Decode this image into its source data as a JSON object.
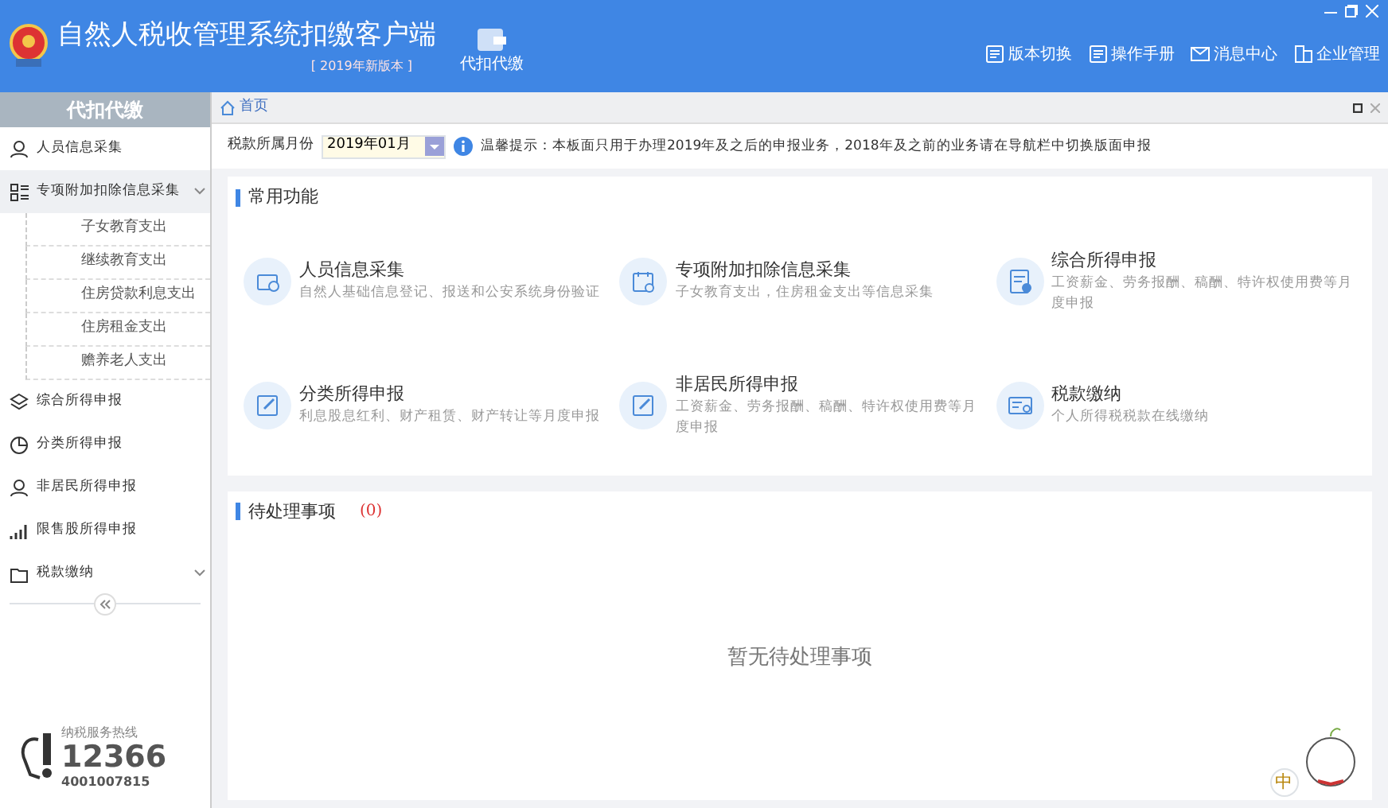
{
  "header": {
    "title": "自然人税收管理系统扣缴客户端",
    "version": "[ 2019年新版本 ]",
    "module": "代扣代缴",
    "tools": [
      {
        "kind": "doc",
        "label": "版本切换"
      },
      {
        "kind": "doc",
        "label": "操作手册"
      },
      {
        "kind": "mail",
        "label": "消息中心"
      },
      {
        "kind": "company",
        "label": "企业管理"
      }
    ]
  },
  "sidebar": {
    "title": "代扣代缴",
    "items": [
      {
        "kind": "person",
        "label": "人员信息采集",
        "expanded": false
      },
      {
        "kind": "grid",
        "label": "专项附加扣除信息采集",
        "expanded": true,
        "collapsible": true,
        "children": [
          {
            "label": "子女教育支出"
          },
          {
            "label": "继续教育支出"
          },
          {
            "label": "住房贷款利息支出"
          },
          {
            "label": "住房租金支出"
          },
          {
            "label": "赡养老人支出"
          }
        ]
      },
      {
        "kind": "layers",
        "label": "综合所得申报",
        "expanded": false
      },
      {
        "kind": "pie",
        "label": "分类所得申报",
        "expanded": false
      },
      {
        "kind": "person",
        "label": "非居民所得申报",
        "expanded": false
      },
      {
        "kind": "bars",
        "label": "限售股所得申报",
        "expanded": false
      },
      {
        "kind": "folder",
        "label": "税款缴纳",
        "expanded": false,
        "collapsible": true
      }
    ],
    "hotline_label": "纳税服务热线",
    "hotline": "12366",
    "phone": "4001007815"
  },
  "tab": {
    "label": "首页"
  },
  "filter": {
    "label": "税款所属月份",
    "value": "2019年01月",
    "hint": "温馨提示：本板面只用于办理2019年及之后的申报业务，2018年及之前的业务请在导航栏中切换版面申报"
  },
  "functions": {
    "title": "常用功能",
    "items": [
      {
        "kind": "id",
        "title": "人员信息采集",
        "desc": "自然人基础信息登记、报送和公安系统身份验证"
      },
      {
        "kind": "calendar",
        "title": "专项附加扣除信息采集",
        "desc": "子女教育支出，住房租金支出等信息采集"
      },
      {
        "kind": "form",
        "title": "综合所得申报",
        "desc": "工资薪金、劳务报酬、稿酬、特许权使用费等月度申报"
      },
      {
        "kind": "edit",
        "title": "分类所得申报",
        "desc": "利息股息红利、财产租赁、财产转让等月度申报"
      },
      {
        "kind": "edit",
        "title": "非居民所得申报",
        "desc": "工资薪金、劳务报酬、稿酬、特许权使用费等月度申报"
      },
      {
        "kind": "card",
        "title": "税款缴纳",
        "desc": "个人所得税税款在线缴纳"
      }
    ]
  },
  "pending": {
    "title": "待处理事项",
    "count": "(0)",
    "empty": "暂无待处理事项"
  },
  "ime": {
    "label": "中"
  }
}
